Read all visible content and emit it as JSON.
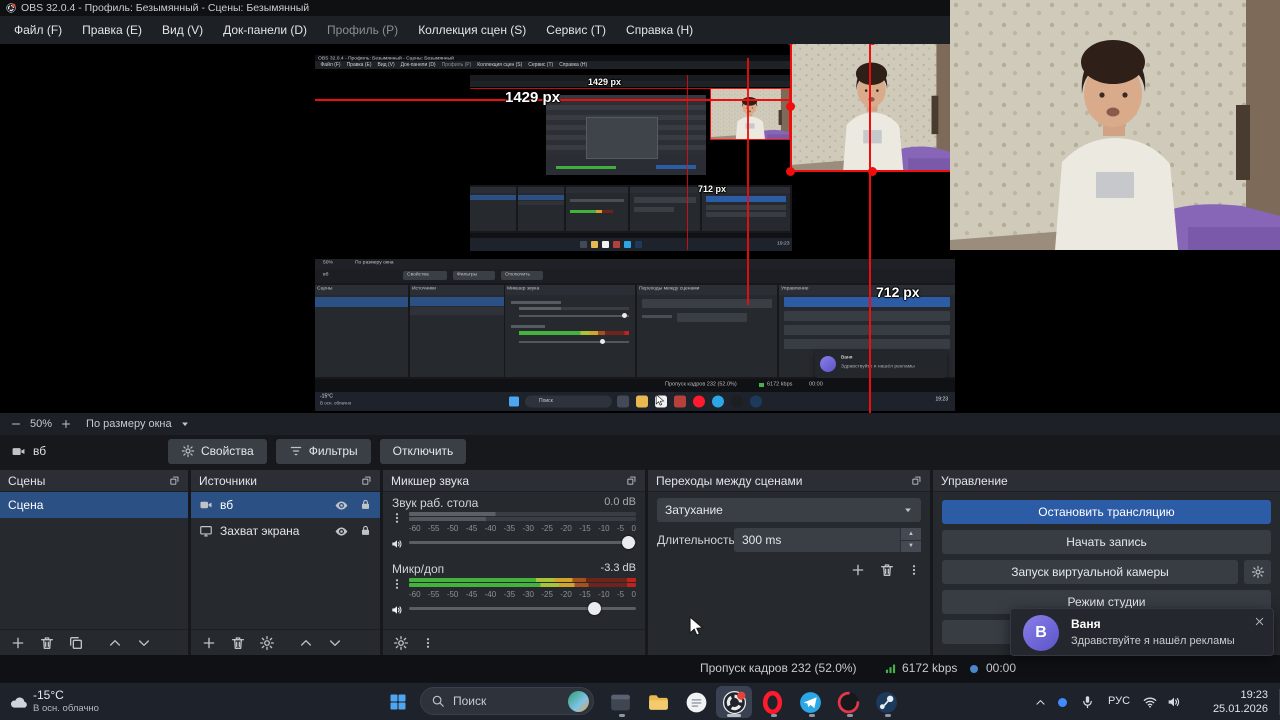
{
  "window": {
    "title": "OBS 32.0.4 - Профиль: Безымянный - Сцены: Безымянный"
  },
  "menubar": {
    "items": [
      {
        "label": "Файл (F)"
      },
      {
        "label": "Правка (E)"
      },
      {
        "label": "Вид (V)"
      },
      {
        "label": "Док-панели (D)"
      },
      {
        "label": "Профиль (P)"
      },
      {
        "label": "Коллекция сцен (S)"
      },
      {
        "label": "Сервис (T)"
      },
      {
        "label": "Справка (H)"
      }
    ]
  },
  "preview": {
    "size_labels": {
      "width_large": "1429 px",
      "width_small": "1429 px",
      "height_large": "712 px",
      "height_small": "712 px"
    }
  },
  "preview_toolbar": {
    "zoom": "50%",
    "fit": "По размеру окна"
  },
  "source_toolbar": {
    "source": "вб",
    "properties": "Свойства",
    "filters": "Фильтры",
    "disable": "Отключить"
  },
  "docks": {
    "scenes": {
      "title": "Сцены",
      "items": [
        {
          "label": "Сцена",
          "selected": true
        }
      ]
    },
    "sources": {
      "title": "Источники",
      "items": [
        {
          "label": "вб",
          "selected": true
        },
        {
          "label": "Захват экрана",
          "selected": false
        }
      ]
    },
    "mixer": {
      "title": "Микшер звука",
      "channels": [
        {
          "name": "Звук раб. стола",
          "level": "0.0 dB"
        },
        {
          "name": "Микр/доп",
          "level": "-3.3 dB"
        }
      ],
      "scale": [
        "-60",
        "-55",
        "-50",
        "-45",
        "-40",
        "-35",
        "-30",
        "-25",
        "-20",
        "-15",
        "-10",
        "-5",
        "0"
      ]
    },
    "transitions": {
      "title": "Переходы между сценами",
      "transition": "Затухание",
      "duration_label": "Длительность",
      "duration_value": "300 ms"
    },
    "controls": {
      "title": "Управление",
      "stream": "Остановить трансляцию",
      "record": "Начать запись",
      "vcam": "Запуск виртуальной камеры",
      "studio": "Режим студии"
    }
  },
  "notification": {
    "avatar_letter": "В",
    "sender": "Ваня",
    "message": "Здравствуйте я нашёл рекламы"
  },
  "statusbar": {
    "dropped": "Пропуск кадров 232 (52.0%)",
    "bitrate": "6172 kbps",
    "time": "00:00"
  },
  "taskbar": {
    "weather_temp": "-15°C",
    "weather_desc": "В осн. облачно",
    "search_placeholder": "Поиск",
    "lang": "РУС",
    "clock_time": "19:23",
    "clock_date": "25.01.2026"
  },
  "colors": {
    "accent_blue": "#2d5ca6",
    "selection_blue": "#2b5084",
    "meter_green": "#3fae3f",
    "overlay_red": "#ef0d0d",
    "avatar_purple": "#7b6fd8"
  }
}
